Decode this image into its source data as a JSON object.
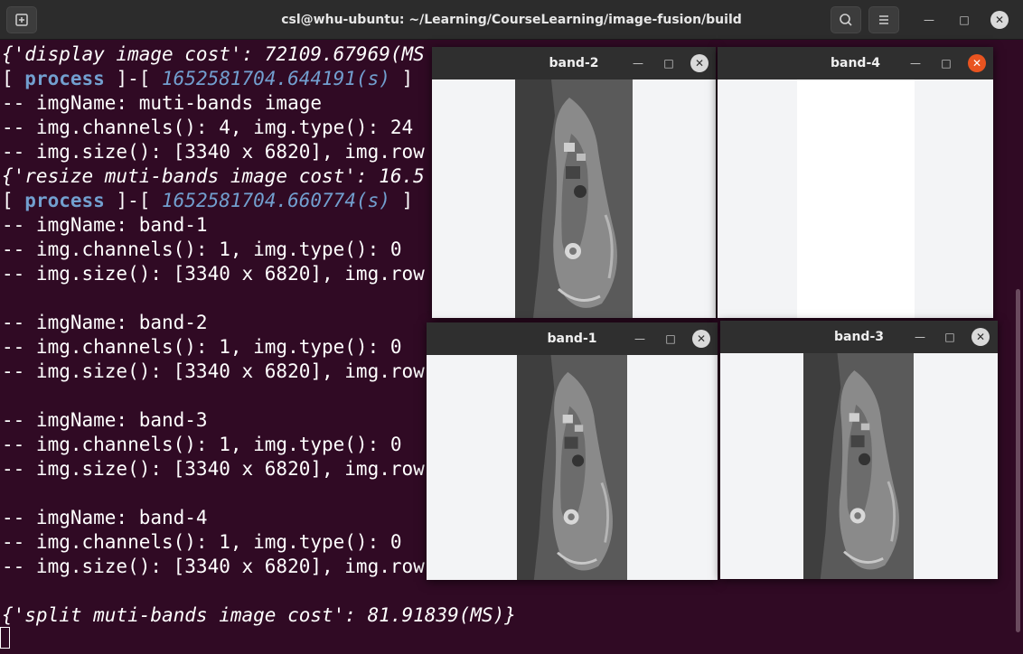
{
  "terminal": {
    "title": "csl@whu-ubuntu: ~/Learning/CourseLearning/image-fusion/build",
    "lines": [
      {
        "text": "{'display image cost': 72109.67969(MS"
      },
      {
        "pre": "[ ",
        "kw": "process",
        "mid": " ]-[ ",
        "ts": "1652581704.644191(s)",
        "post": " ]"
      },
      {
        "text": "-- imgName: muti-bands image"
      },
      {
        "text": "-- img.channels(): 4, img.type(): 24"
      },
      {
        "text": "-- img.size(): [3340 x 6820], img.row"
      },
      {
        "text": "{'resize muti-bands image cost': 16.5"
      },
      {
        "pre": "[ ",
        "kw": "process",
        "mid": " ]-[ ",
        "ts": "1652581704.660774(s)",
        "post": " ]"
      },
      {
        "text": "-- imgName: band-1"
      },
      {
        "text": "-- img.channels(): 1, img.type(): 0"
      },
      {
        "text": "-- img.size(): [3340 x 6820], img.row"
      },
      {
        "text": "-- imgName: band-2"
      },
      {
        "text": "-- img.channels(): 1, img.type(): 0"
      },
      {
        "text": "-- img.size(): [3340 x 6820], img.row"
      },
      {
        "text": "-- imgName: band-3"
      },
      {
        "text": "-- img.channels(): 1, img.type(): 0"
      },
      {
        "text": "-- img.size(): [3340 x 6820], img.row"
      },
      {
        "text": "-- imgName: band-4"
      },
      {
        "text": "-- img.channels(): 1, img.type(): 0"
      },
      {
        "text": "-- img.size(): [3340 x 6820], img.row"
      },
      {
        "text": "{'split muti-bands image cost': 81.91839(MS)}"
      }
    ]
  },
  "icons": {
    "new_tab": "new-tab-icon",
    "search": "search-icon",
    "menu": "hamburger-menu-icon",
    "minimize": "minimize-icon",
    "maximize": "maximize-icon",
    "close": "close-icon"
  },
  "windows": {
    "band2": {
      "title": "band-2"
    },
    "band4": {
      "title": "band-4"
    },
    "band1": {
      "title": "band-1"
    },
    "band3": {
      "title": "band-3"
    }
  },
  "colors": {
    "terminal_bg": "#300a24",
    "keyword": "#729fcf",
    "close_active": "#e95420"
  }
}
